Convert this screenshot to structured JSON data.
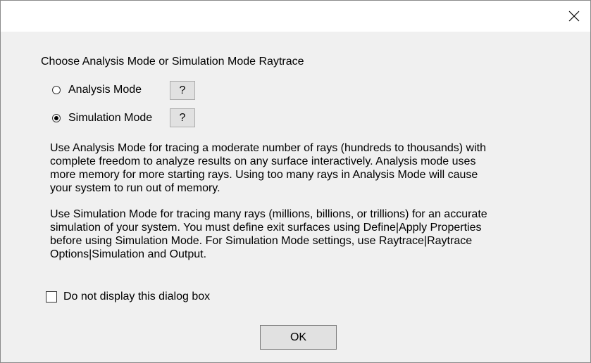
{
  "dialog": {
    "close_icon": "close-icon",
    "heading": "Choose Analysis Mode or Simulation Mode Raytrace",
    "modes": [
      {
        "label": "Analysis Mode",
        "selected": false,
        "help_label": "?"
      },
      {
        "label": "Simulation Mode",
        "selected": true,
        "help_label": "?"
      }
    ],
    "description_analysis": "Use Analysis Mode for tracing a moderate number of rays (hundreds to thousands) with complete freedom to analyze results on any surface interactively. Analysis mode uses more memory for more starting rays. Using too many rays in Analysis Mode will cause your system to run out of memory.",
    "description_simulation": "Use Simulation Mode for tracing many rays (millions, billions, or trillions) for an accurate simulation of your system. You must define exit surfaces using Define|Apply Properties before using Simulation Mode. For Simulation Mode settings, use Raytrace|Raytrace Options|Simulation and Output.",
    "dont_show_label": "Do not display this dialog box",
    "dont_show_checked": false,
    "ok_label": "OK"
  }
}
